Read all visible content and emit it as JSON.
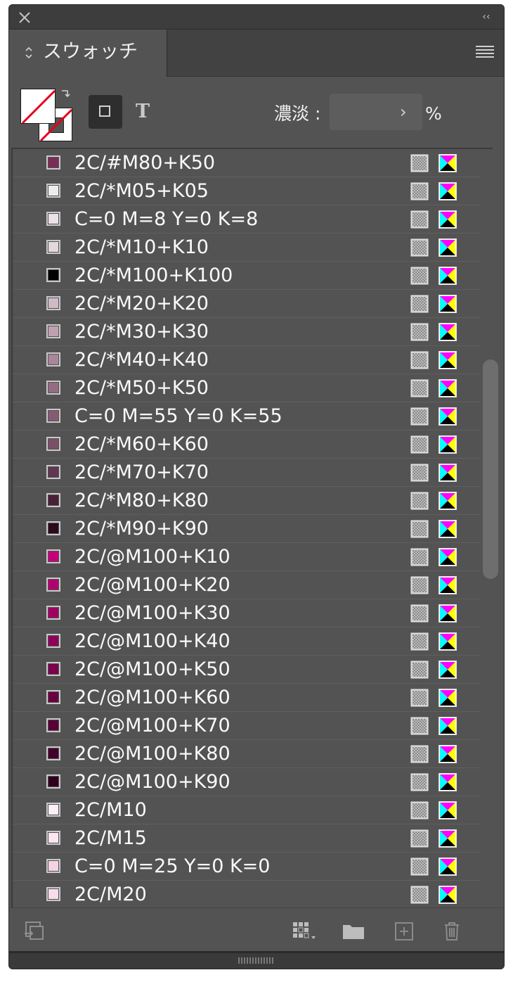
{
  "panel": {
    "tab_label": "スウォッチ",
    "tint_label": "濃淡 :",
    "tint_value": "",
    "tint_unit": "%",
    "collapse_glyph": "‹‹",
    "text_button_glyph": "T"
  },
  "icons": {
    "close": "close-icon",
    "collapse": "collapse-double-chevron-icon",
    "panel_menu": "hamburger-menu-icon",
    "spot_color": "spot-color-icon",
    "cmyk_mode": "cmyk-mode-icon",
    "show_kinds": "show-swatch-kinds-icon",
    "new_group": "new-color-group-icon",
    "new_swatch": "new-swatch-icon",
    "delete": "trash-icon",
    "place_swatches": "place-swatches-icon"
  },
  "swatches": [
    {
      "name": "2C/#M80+K50",
      "color": "#7b2b57"
    },
    {
      "name": "2C/*M05+K05",
      "color": "#efebee"
    },
    {
      "name": "C=0 M=8 Y=0 K=8",
      "color": "#ebe1e8"
    },
    {
      "name": "2C/*M10+K10",
      "color": "#e3d8de"
    },
    {
      "name": "2C/*M100+K100",
      "color": "#000000"
    },
    {
      "name": "2C/*M20+K20",
      "color": "#cfbac6"
    },
    {
      "name": "2C/*M30+K30",
      "color": "#bfa0b1"
    },
    {
      "name": "2C/*M40+K40",
      "color": "#a9869a"
    },
    {
      "name": "2C/*M50+K50",
      "color": "#946c83"
    },
    {
      "name": "C=0 M=55 Y=0 K=55",
      "color": "#865a73"
    },
    {
      "name": "2C/*M60+K60",
      "color": "#7b4f68"
    },
    {
      "name": "2C/*M70+K70",
      "color": "#613650"
    },
    {
      "name": "2C/*M80+K80",
      "color": "#4a1f38"
    },
    {
      "name": "2C/*M90+K90",
      "color": "#2a0a1c"
    },
    {
      "name": "2C/@M100+K10",
      "color": "#c5007a"
    },
    {
      "name": "2C/@M100+K20",
      "color": "#b20070"
    },
    {
      "name": "2C/@M100+K30",
      "color": "#a00064"
    },
    {
      "name": "2C/@M100+K40",
      "color": "#8f0059"
    },
    {
      "name": "2C/@M100+K50",
      "color": "#7c004d"
    },
    {
      "name": "2C/@M100+K60",
      "color": "#690041"
    },
    {
      "name": "2C/@M100+K70",
      "color": "#560035"
    },
    {
      "name": "2C/@M100+K80",
      "color": "#42002a"
    },
    {
      "name": "2C/@M100+K90",
      "color": "#2f001d"
    },
    {
      "name": "2C/M10",
      "color": "#fdeff6"
    },
    {
      "name": "2C/M15",
      "color": "#fbe6f0"
    },
    {
      "name": "C=0 M=25 Y=0 K=0",
      "color": "#f5d2e3"
    },
    {
      "name": "2C/M20",
      "color": "#f7dcea"
    }
  ]
}
